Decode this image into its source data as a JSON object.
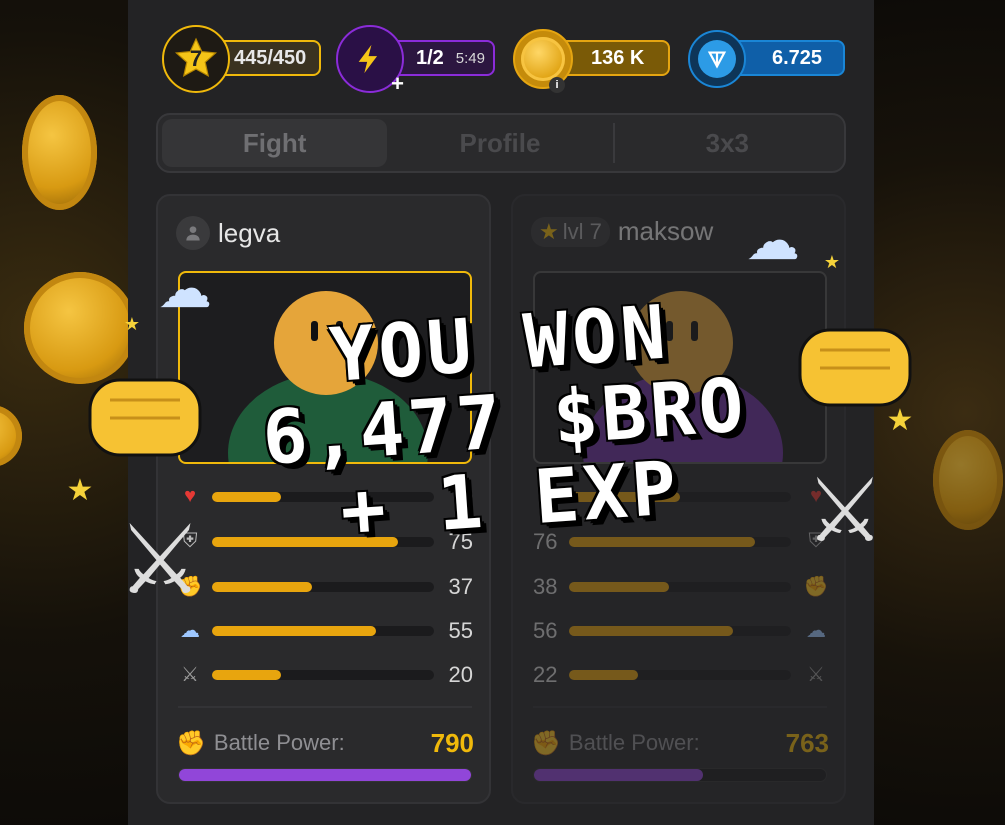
{
  "topbar": {
    "level": {
      "number": "7",
      "exp": "445/450"
    },
    "energy": {
      "value": "1/2",
      "timer": "5:49"
    },
    "coins": {
      "value": "136 K"
    },
    "ton": {
      "value": "6.725"
    }
  },
  "tabs": [
    {
      "label": "Fight",
      "active": true
    },
    {
      "label": "Profile",
      "active": false
    },
    {
      "label": "3x3",
      "active": false
    }
  ],
  "player_left": {
    "name": "legva",
    "stats": [
      {
        "icon": "heart-icon",
        "value": "0",
        "fill": 0.31
      },
      {
        "icon": "shield-icon",
        "value": "75",
        "fill": 0.84
      },
      {
        "icon": "fist-icon",
        "value": "37",
        "fill": 0.45
      },
      {
        "icon": "wind-icon",
        "value": "55",
        "fill": 0.74
      },
      {
        "icon": "swords-icon",
        "value": "20",
        "fill": 0.31
      }
    ],
    "battle_power_label": "Battle Power:",
    "battle_power": "790",
    "power_fill": 1.0
  },
  "player_right": {
    "level_badge": "lvl 7",
    "name": "maksow",
    "stats": [
      {
        "icon": "heart-icon",
        "value": "",
        "fill": 0.5
      },
      {
        "icon": "shield-icon",
        "value": "76",
        "fill": 0.84
      },
      {
        "icon": "fist-icon",
        "value": "38",
        "fill": 0.45
      },
      {
        "icon": "wind-icon",
        "value": "56",
        "fill": 0.74
      },
      {
        "icon": "swords-icon",
        "value": "22",
        "fill": 0.31
      }
    ],
    "battle_power_label": "Battle Power:",
    "battle_power": "763",
    "power_fill": 0.58
  },
  "overlay": {
    "line1": "YOU WON",
    "line2": "6,477 $BRO",
    "line3": "+ 1 EXP"
  },
  "colors": {
    "accent": "#f0b90b",
    "energy": "#8b2cd9",
    "ton": "#1a86d6",
    "power": "#9146d9"
  }
}
